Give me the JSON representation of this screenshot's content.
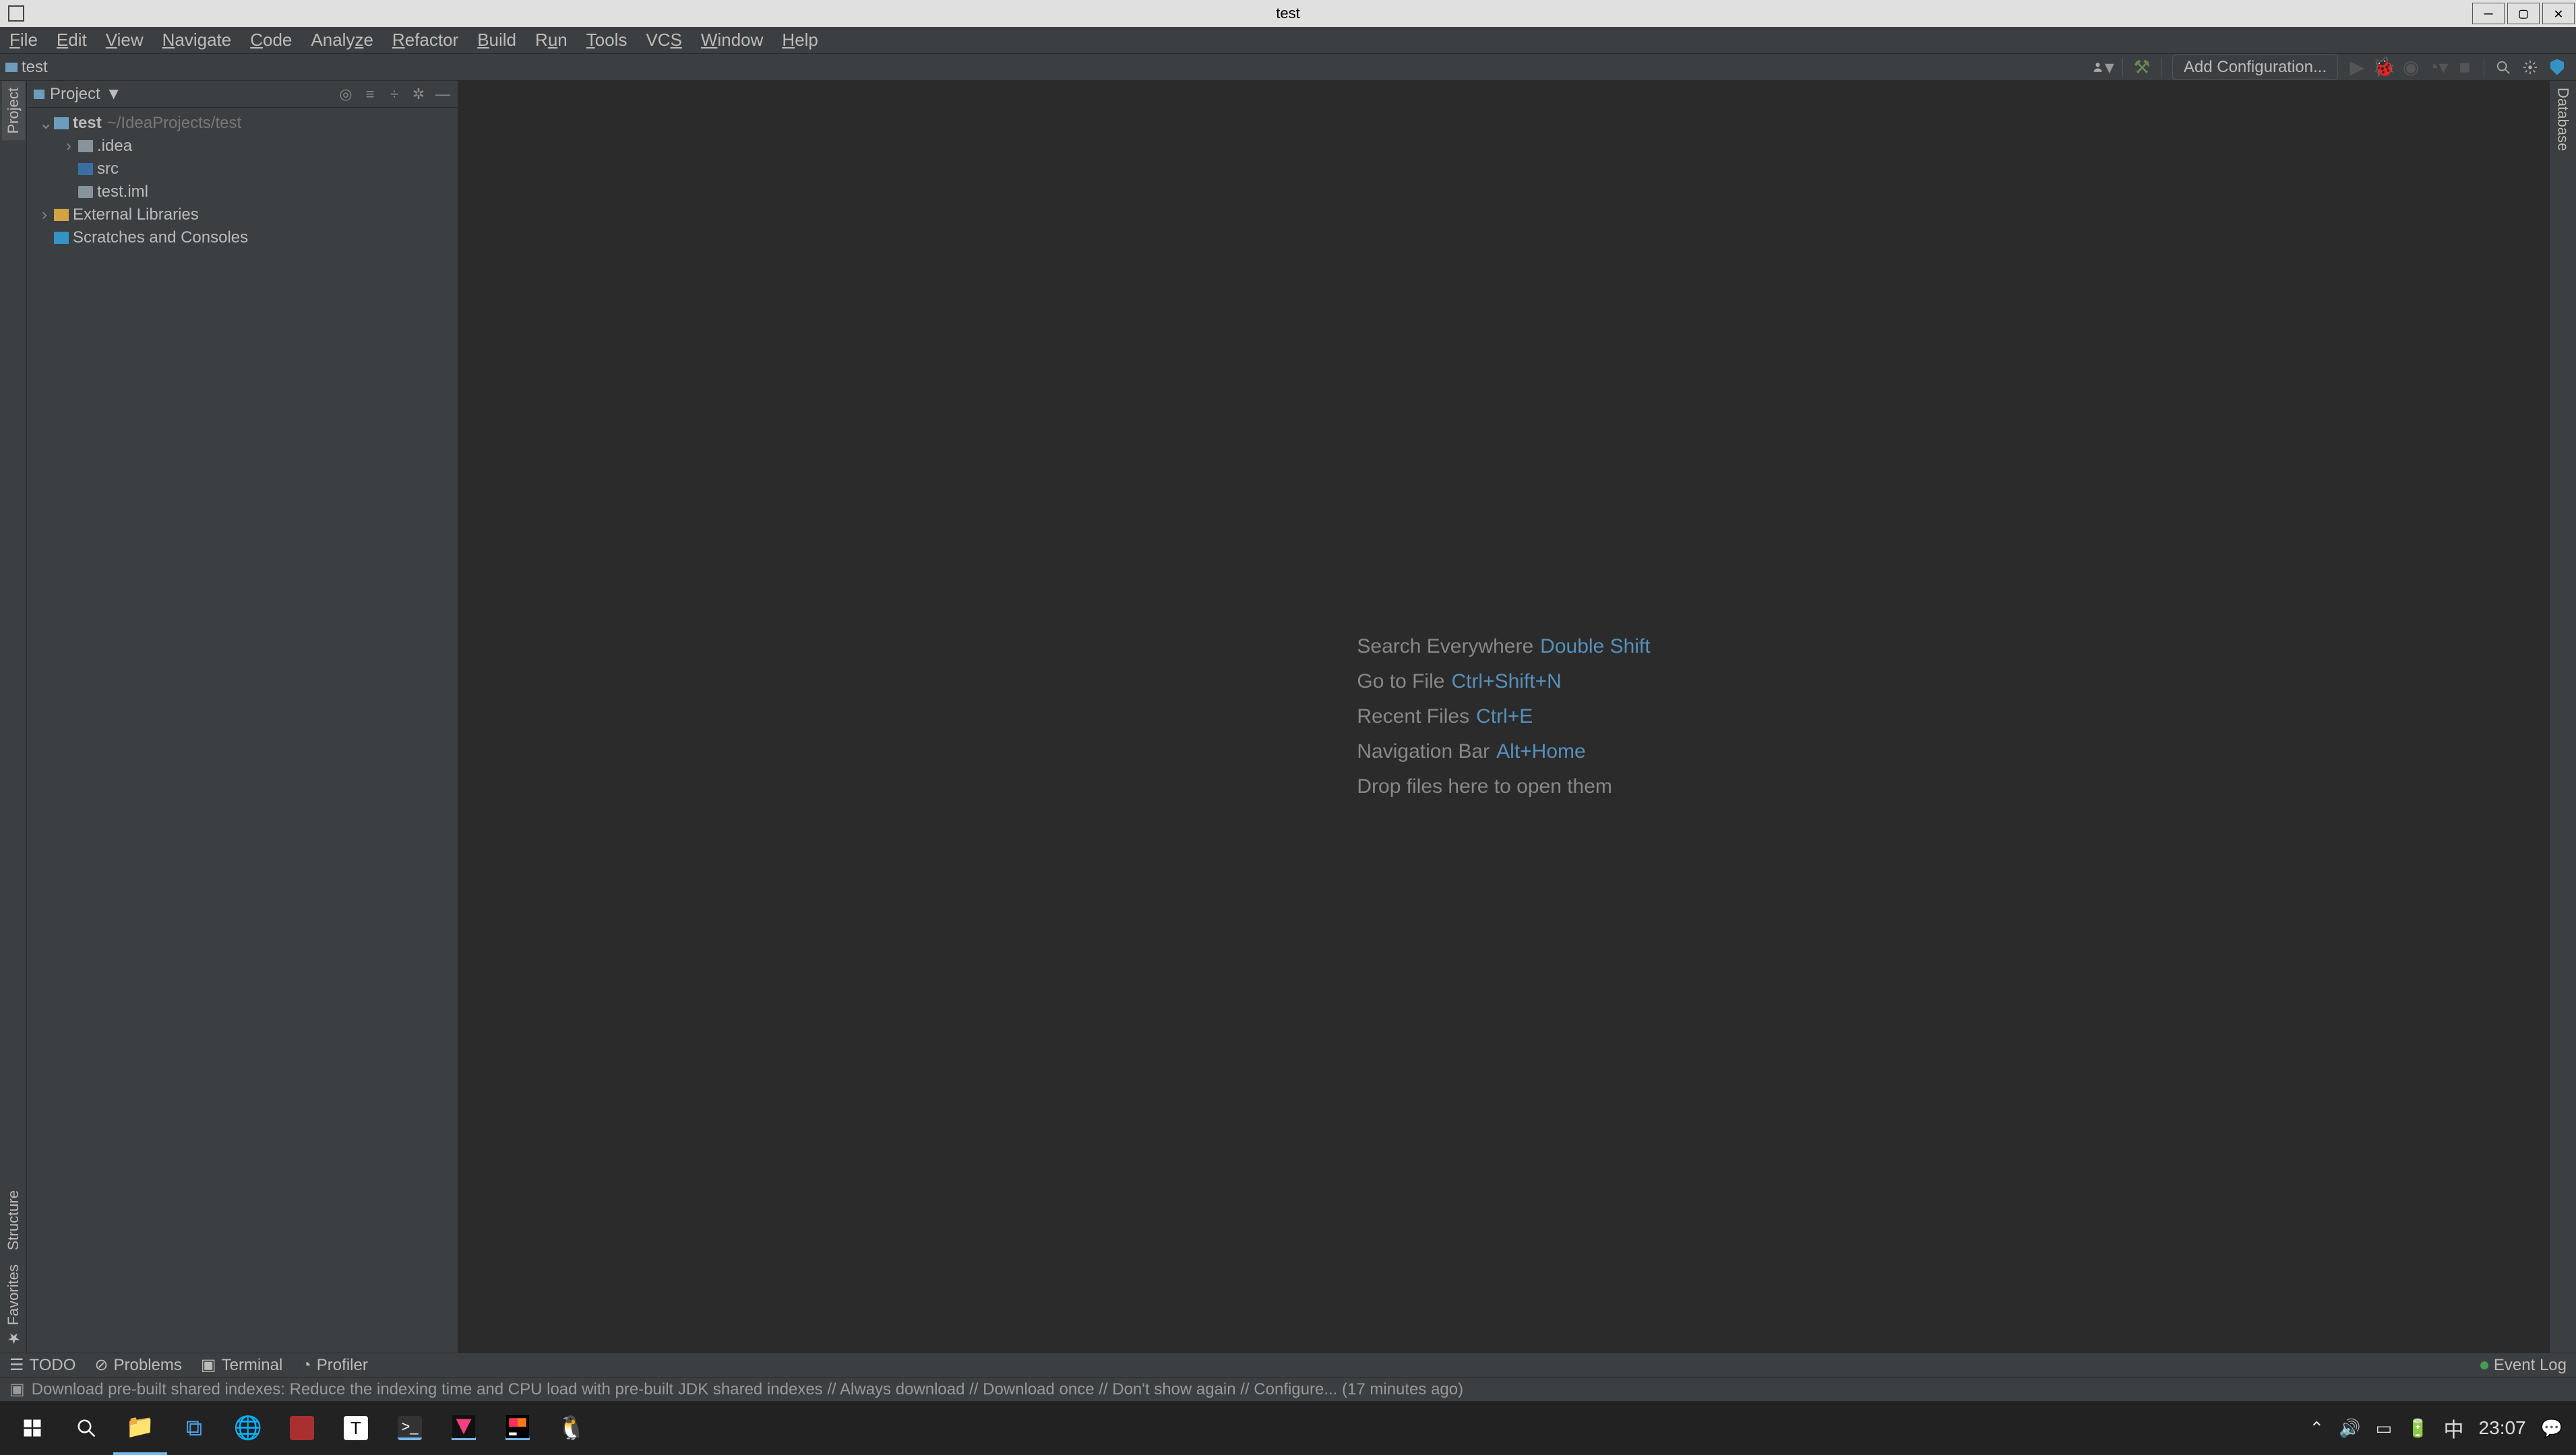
{
  "titlebar": {
    "title": "test"
  },
  "menu": {
    "file": "File",
    "edit": "Edit",
    "view": "View",
    "navigate": "Navigate",
    "code": "Code",
    "analyze": "Analyze",
    "refactor": "Refactor",
    "build": "Build",
    "run": "Run",
    "tools": "Tools",
    "vcs": "VCS",
    "window": "Window",
    "help": "Help"
  },
  "nav": {
    "crumb": "test",
    "addconf": "Add Configuration..."
  },
  "left": {
    "project": "Project",
    "structure": "Structure",
    "favorites": "Favorites"
  },
  "right": {
    "database": "Database"
  },
  "panel": {
    "title": "Project"
  },
  "tree": {
    "root": "test",
    "rootHint": "~/IdeaProjects/test",
    "idea": ".idea",
    "src": "src",
    "iml": "test.iml",
    "ext": "External Libraries",
    "scratch": "Scratches and Consoles"
  },
  "welcome": {
    "l1": "Search Everywhere",
    "s1": "Double Shift",
    "l2": "Go to File",
    "s2": "Ctrl+Shift+N",
    "l3": "Recent Files",
    "s3": "Ctrl+E",
    "l4": "Navigation Bar",
    "s4": "Alt+Home",
    "l5": "Drop files here to open them"
  },
  "bottom": {
    "todo": "TODO",
    "problems": "Problems",
    "terminal": "Terminal",
    "profiler": "Profiler",
    "eventlog": "Event Log"
  },
  "status": {
    "msg": "Download pre-built shared indexes: Reduce the indexing time and CPU load with pre-built JDK shared indexes // Always download // Download once // Don't show again // Configure... (17 minutes ago)"
  },
  "taskbar": {
    "ime": "中",
    "clock": "23:07"
  }
}
